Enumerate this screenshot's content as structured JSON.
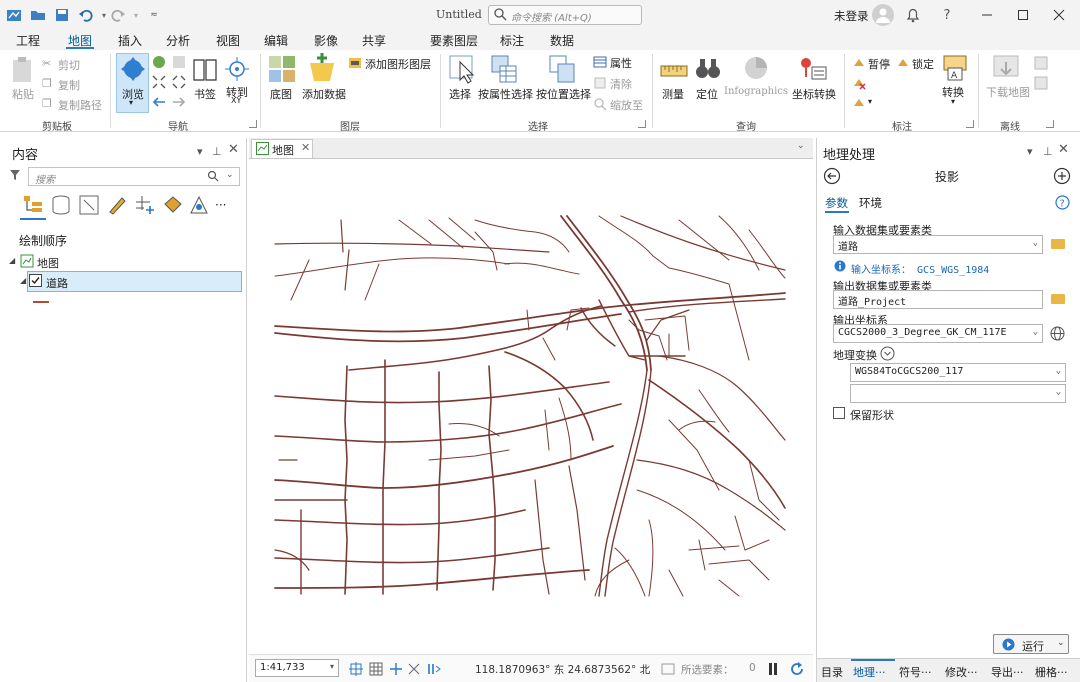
{
  "window": {
    "doc_title": "Untitled",
    "search_placeholder": "命令搜索 (Alt+Q)",
    "user": "未登录",
    "help": "?"
  },
  "ribbon_tabs": [
    "工程",
    "地图",
    "插入",
    "分析",
    "视图",
    "编辑",
    "影像",
    "共享"
  ],
  "context_tabs": [
    "要素图层",
    "标注",
    "数据"
  ],
  "active_tab": "地图",
  "ribbon": {
    "clipboard": {
      "paste": "粘贴",
      "cut": "剪切",
      "copy": "复制",
      "copy_path": "复制路径",
      "group": "剪贴板"
    },
    "navigate": {
      "explore": "浏览",
      "bookmarks": "书签",
      "goto": "转到",
      "goto_sub": "XY",
      "group": "导航"
    },
    "layer": {
      "basemap": "底图",
      "add_data": "添加数据",
      "add_graphics": "添加图形图层",
      "group": "图层"
    },
    "selection": {
      "select": "选择",
      "by_attr": "按属性选择",
      "by_loc": "按位置选择",
      "attributes": "属性",
      "clear": "清除",
      "zoom_to": "缩放至",
      "group": "选择"
    },
    "inquiry": {
      "measure": "测量",
      "locate": "定位",
      "infographics": "Infographics",
      "coord_convert": "坐标转换",
      "group": "查询"
    },
    "labeling": {
      "pause": "暂停",
      "lock": "锁定",
      "convert": "转换",
      "group": "标注"
    },
    "offline": {
      "download_map": "下载地图",
      "group": "离线"
    }
  },
  "contents": {
    "title": "内容",
    "search_placeholder": "搜索",
    "draw_order": "绘制顺序",
    "map_name": "地图",
    "layer_name": "道路",
    "more": "···",
    "symbol_color": "#b24a3f"
  },
  "map": {
    "tab_label": "地图",
    "road_color": "#7a3a33",
    "scale": "1:41,733",
    "coords": "118.1870963° 东 24.6873562° 北",
    "selected_features": "所选要素：",
    "selected_count": "0"
  },
  "geoprocessing": {
    "title": "地理处理",
    "tool": "投影",
    "tabs": [
      "参数",
      "环境"
    ],
    "input_label": "输入数据集或要素类",
    "input_value": "道路",
    "input_crs_label": "输入坐标系：",
    "input_crs_value": "GCS_WGS_1984",
    "output_label": "输出数据集或要素类",
    "output_value": "道路_Project",
    "out_crs_label": "输出坐标系",
    "out_crs_value": "CGCS2000_3_Degree_GK_CM_117E",
    "transform_label": "地理变换",
    "transform_value": "WGS84ToCGCS200_117",
    "transform_value_2": "",
    "preserve_shape": "保留形状",
    "run": "运行",
    "bottom_tabs": [
      "目录",
      "地理···",
      "符号···",
      "修改···",
      "导出···",
      "栅格···"
    ]
  }
}
